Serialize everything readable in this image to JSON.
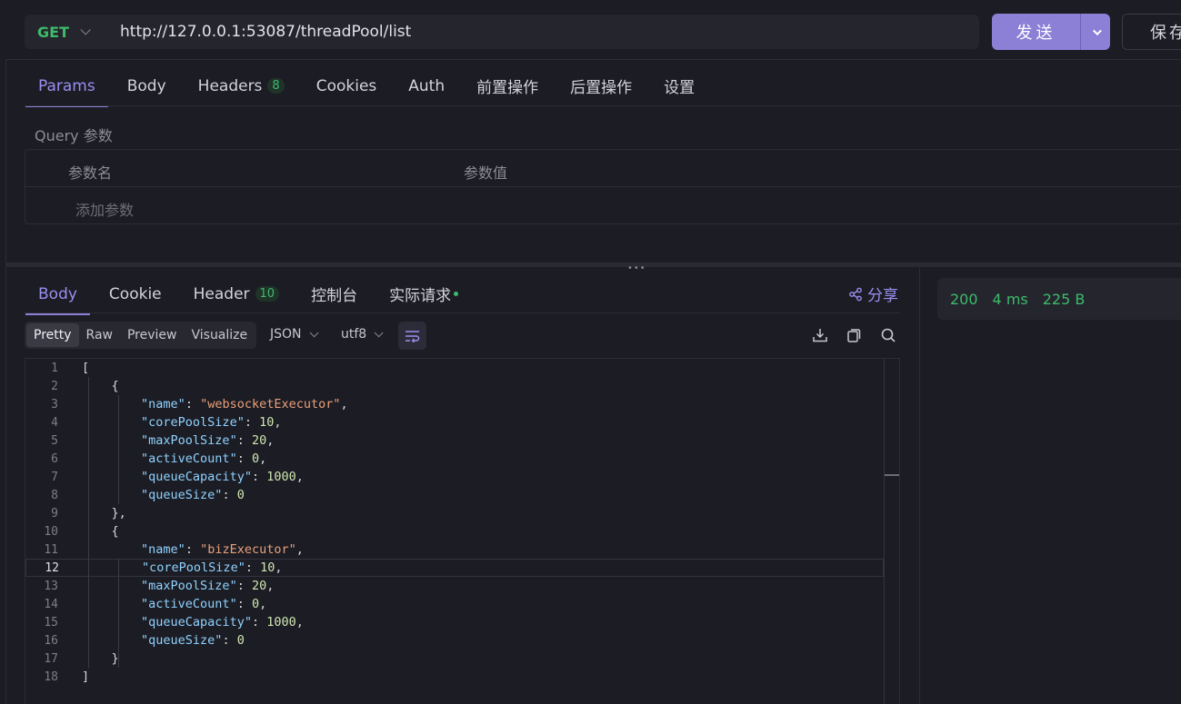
{
  "request": {
    "method": "GET",
    "url": "http://127.0.0.1:53087/threadPool/list",
    "send_label": "发送",
    "save_label": "保存"
  },
  "request_tabs": [
    {
      "label": "Params",
      "active": true
    },
    {
      "label": "Body"
    },
    {
      "label": "Headers",
      "badge": "8"
    },
    {
      "label": "Cookies"
    },
    {
      "label": "Auth"
    },
    {
      "label": "前置操作"
    },
    {
      "label": "后置操作"
    },
    {
      "label": "设置"
    }
  ],
  "params": {
    "section_label": "Query 参数",
    "col_name": "参数名",
    "col_value": "参数值",
    "add_label": "添加参数"
  },
  "response_tabs": [
    {
      "label": "Body",
      "active": true
    },
    {
      "label": "Cookie"
    },
    {
      "label": "Header",
      "badge": "10"
    },
    {
      "label": "控制台"
    },
    {
      "label": "实际请求",
      "dot": true
    }
  ],
  "share_label": "分享",
  "format_tabs": [
    "Pretty",
    "Raw",
    "Preview",
    "Visualize"
  ],
  "format_active": "Pretty",
  "lang_select": "JSON",
  "encoding_select": "utf8",
  "status": {
    "code": "200",
    "time": "4 ms",
    "size": "225 B"
  },
  "code_lines": [
    "[",
    "    {",
    "        \"name\": \"websocketExecutor\",",
    "        \"corePoolSize\": 10,",
    "        \"maxPoolSize\": 20,",
    "        \"activeCount\": 0,",
    "        \"queueCapacity\": 1000,",
    "        \"queueSize\": 0",
    "    },",
    "    {",
    "        \"name\": \"bizExecutor\",",
    "        \"corePoolSize\": 10,",
    "        \"maxPoolSize\": 20,",
    "        \"activeCount\": 0,",
    "        \"queueCapacity\": 1000,",
    "        \"queueSize\": 0",
    "    }",
    "]"
  ],
  "current_line": 12,
  "colors": {
    "accent": "#8b7fd6",
    "success": "#3dbb6a",
    "background": "#1c1c24"
  }
}
